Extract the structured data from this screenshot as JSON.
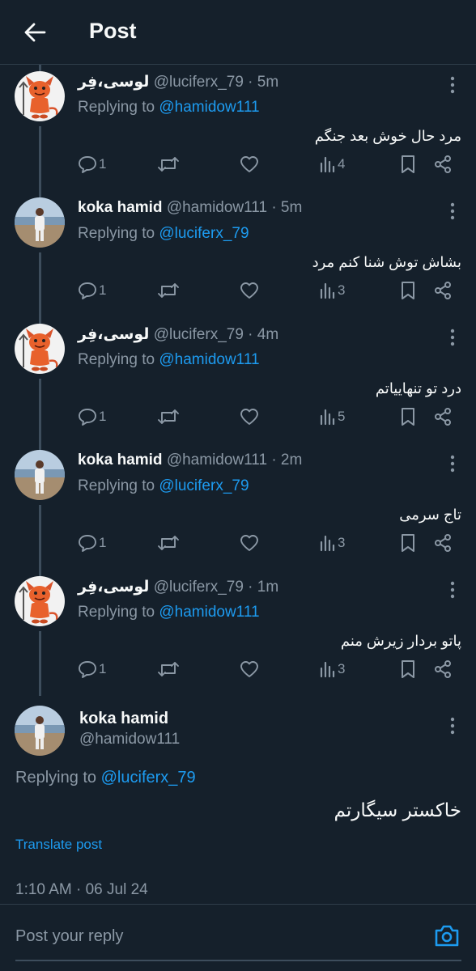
{
  "header": {
    "title": "Post"
  },
  "replies": [
    {
      "name": "لوسی،فِر",
      "handle": "@luciferx_79",
      "time": "· 5m",
      "replying_prefix": "Replying to ",
      "replying_to": "@hamidow111",
      "text": "مرد حال خوش بعد جنگم",
      "replies": "1",
      "views": "4",
      "avatar": "devil"
    },
    {
      "name": "koka hamid",
      "handle": "@hamidow111",
      "time": "· 5m",
      "replying_prefix": "Replying to ",
      "replying_to": "@luciferx_79",
      "text": "بشاش توش شنا کنم مرد",
      "replies": "1",
      "views": "3",
      "avatar": "beach"
    },
    {
      "name": "لوسی،فِر",
      "handle": "@luciferx_79",
      "time": "· 4m",
      "replying_prefix": "Replying to ",
      "replying_to": "@hamidow111",
      "text": "درد تو تنهاییاتم",
      "replies": "1",
      "views": "5",
      "avatar": "devil"
    },
    {
      "name": "koka hamid",
      "handle": "@hamidow111",
      "time": "· 2m",
      "replying_prefix": "Replying to ",
      "replying_to": "@luciferx_79",
      "text": "تاج سرمی",
      "replies": "1",
      "views": "3",
      "avatar": "beach"
    },
    {
      "name": "لوسی،فِر",
      "handle": "@luciferx_79",
      "time": "· 1m",
      "replying_prefix": "Replying to ",
      "replying_to": "@hamidow111",
      "text": "پاتو بردار زیرش منم",
      "replies": "1",
      "views": "3",
      "avatar": "devil"
    }
  ],
  "main_post": {
    "name": "koka hamid",
    "handle": "@hamidow111",
    "replying_prefix": "Replying to ",
    "replying_to": "@luciferx_79",
    "text": "خاکستر سیگارتم",
    "translate": "Translate post",
    "timestamp": "1:10 AM · 06 Jul 24"
  },
  "reply_bar": {
    "placeholder": "Post your reply"
  },
  "colors": {
    "background": "#15202b",
    "accent": "#1d9bf0",
    "secondary_text": "#8b98a5"
  }
}
